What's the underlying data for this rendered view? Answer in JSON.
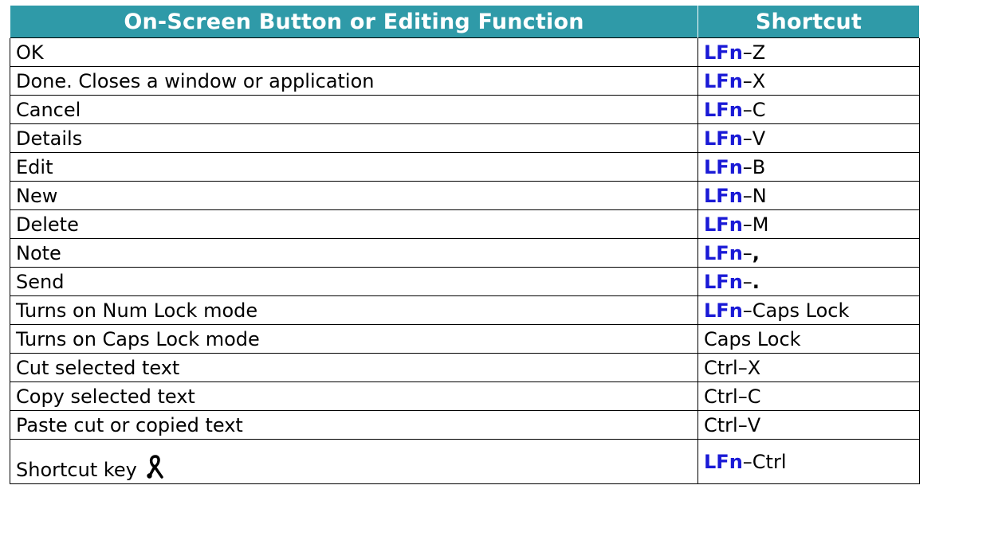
{
  "table": {
    "headers": [
      "On-Screen Button or Editing Function",
      "Shortcut"
    ],
    "rows": [
      {
        "function": "OK",
        "modifier": "LFn",
        "separator": "–",
        "key": "Z",
        "key_bold": false
      },
      {
        "function": "Done.  Closes a window or application",
        "modifier": "LFn",
        "separator": "–",
        "key": "X",
        "key_bold": false
      },
      {
        "function": "Cancel",
        "modifier": "LFn",
        "separator": "–",
        "key": "C",
        "key_bold": false
      },
      {
        "function": "Details",
        "modifier": "LFn",
        "separator": "–",
        "key": "V",
        "key_bold": false
      },
      {
        "function": "Edit",
        "modifier": "LFn",
        "separator": "–",
        "key": "B",
        "key_bold": false
      },
      {
        "function": "New",
        "modifier": "LFn",
        "separator": "–",
        "key": "N",
        "key_bold": false
      },
      {
        "function": "Delete",
        "modifier": "LFn",
        "separator": "–",
        "key": "M",
        "key_bold": false
      },
      {
        "function": "Note",
        "modifier": "LFn",
        "separator": "–",
        "key": ",",
        "key_bold": true
      },
      {
        "function": "Send",
        "modifier": "LFn",
        "separator": "–",
        "key": ".",
        "key_bold": true
      },
      {
        "function": "Turns on Num Lock mode",
        "modifier": "LFn",
        "separator": "–",
        "key": "Caps Lock",
        "key_bold": false
      },
      {
        "function": "Turns on Caps Lock mode",
        "modifier": "",
        "separator": "",
        "key": "Caps Lock",
        "key_bold": false
      },
      {
        "function": "Cut selected text",
        "modifier": "",
        "separator": "",
        "key": "Ctrl–X",
        "key_bold": false
      },
      {
        "function": "Copy selected text",
        "modifier": "",
        "separator": "",
        "key": "Ctrl–C",
        "key_bold": false
      },
      {
        "function": "Paste cut or copied text",
        "modifier": "",
        "separator": "",
        "key": "Ctrl–V",
        "key_bold": false
      },
      {
        "function": "Shortcut key",
        "modifier": "LFn",
        "separator": "–",
        "key": "Ctrl",
        "key_bold": false,
        "icon": "shortcut-key-symbol-icon"
      }
    ]
  },
  "colors": {
    "header_background": "#2f9aa8",
    "header_text": "#ffffff",
    "modifier_text": "#1a1ad6",
    "body_text": "#000000"
  }
}
